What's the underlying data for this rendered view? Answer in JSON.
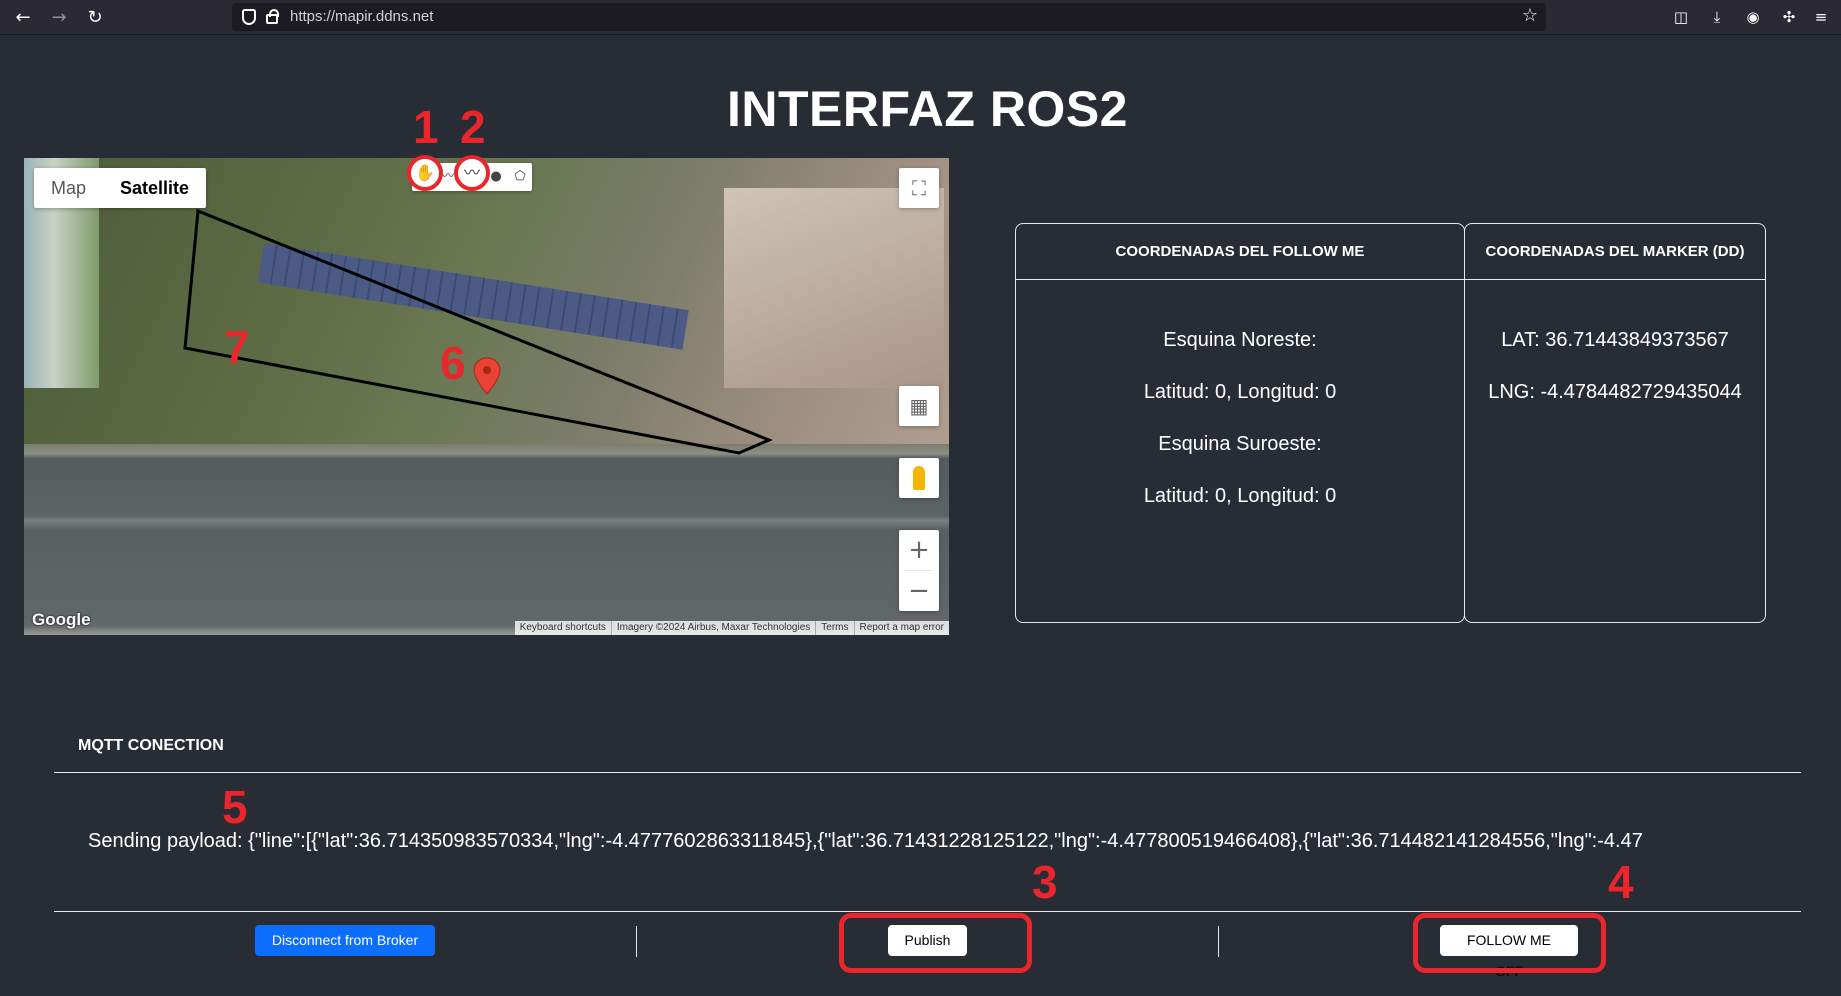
{
  "browser": {
    "url": "https://mapir.ddns.net",
    "icons": [
      "back-arrow-icon",
      "forward-arrow-icon",
      "reload-icon",
      "shield-icon",
      "lock-icon",
      "bookmark-star-icon",
      "pocket-icon",
      "download-icon",
      "account-icon",
      "extensions-icon",
      "menu-icon"
    ]
  },
  "page": {
    "title": "INTERFAZ ROS2"
  },
  "map": {
    "type_map": "Map",
    "type_satellite": "Satellite",
    "selected_type": "Satellite",
    "attribution": [
      "Keyboard shortcuts",
      "Imagery ©2024 Airbus, Maxar Technologies",
      "Terms",
      "Report a map error"
    ],
    "logo": "Google",
    "draw_tools": [
      "hand-icon",
      "polyline-icon",
      "rectangle-icon",
      "circle-icon",
      "polygon-icon"
    ]
  },
  "follow_me": {
    "header": "COORDENADAS DEL FOLLOW ME",
    "ne_label": "Esquina Noreste:",
    "ne_value": "Latitud: 0, Longitud: 0",
    "sw_label": "Esquina Suroeste:",
    "sw_value": "Latitud: 0, Longitud: 0"
  },
  "marker": {
    "header": "COORDENADAS DEL MARKER (DD)",
    "lat": "LAT: 36.71443849373567",
    "lng": "LNG: -4.4784482729435044"
  },
  "mqtt": {
    "title": "MQTT CONECTION",
    "payload": "Sending payload: {\"line\":[{\"lat\":36.714350983570334,\"lng\":-4.4777602863311845},{\"lat\":36.71431228125122,\"lng\":-4.477800519466408},{\"lat\":36.714482141284556,\"lng\":-4.47",
    "disconnect_label": "Disconnect from Broker",
    "publish_label": "Publish",
    "follow_label": "FOLLOW ME OFF"
  },
  "annotations": [
    "1",
    "2",
    "3",
    "4",
    "5",
    "6",
    "7"
  ],
  "colors": {
    "background": "#282c34",
    "annotation": "#e8262b",
    "primary_button": "#0d6efd"
  }
}
